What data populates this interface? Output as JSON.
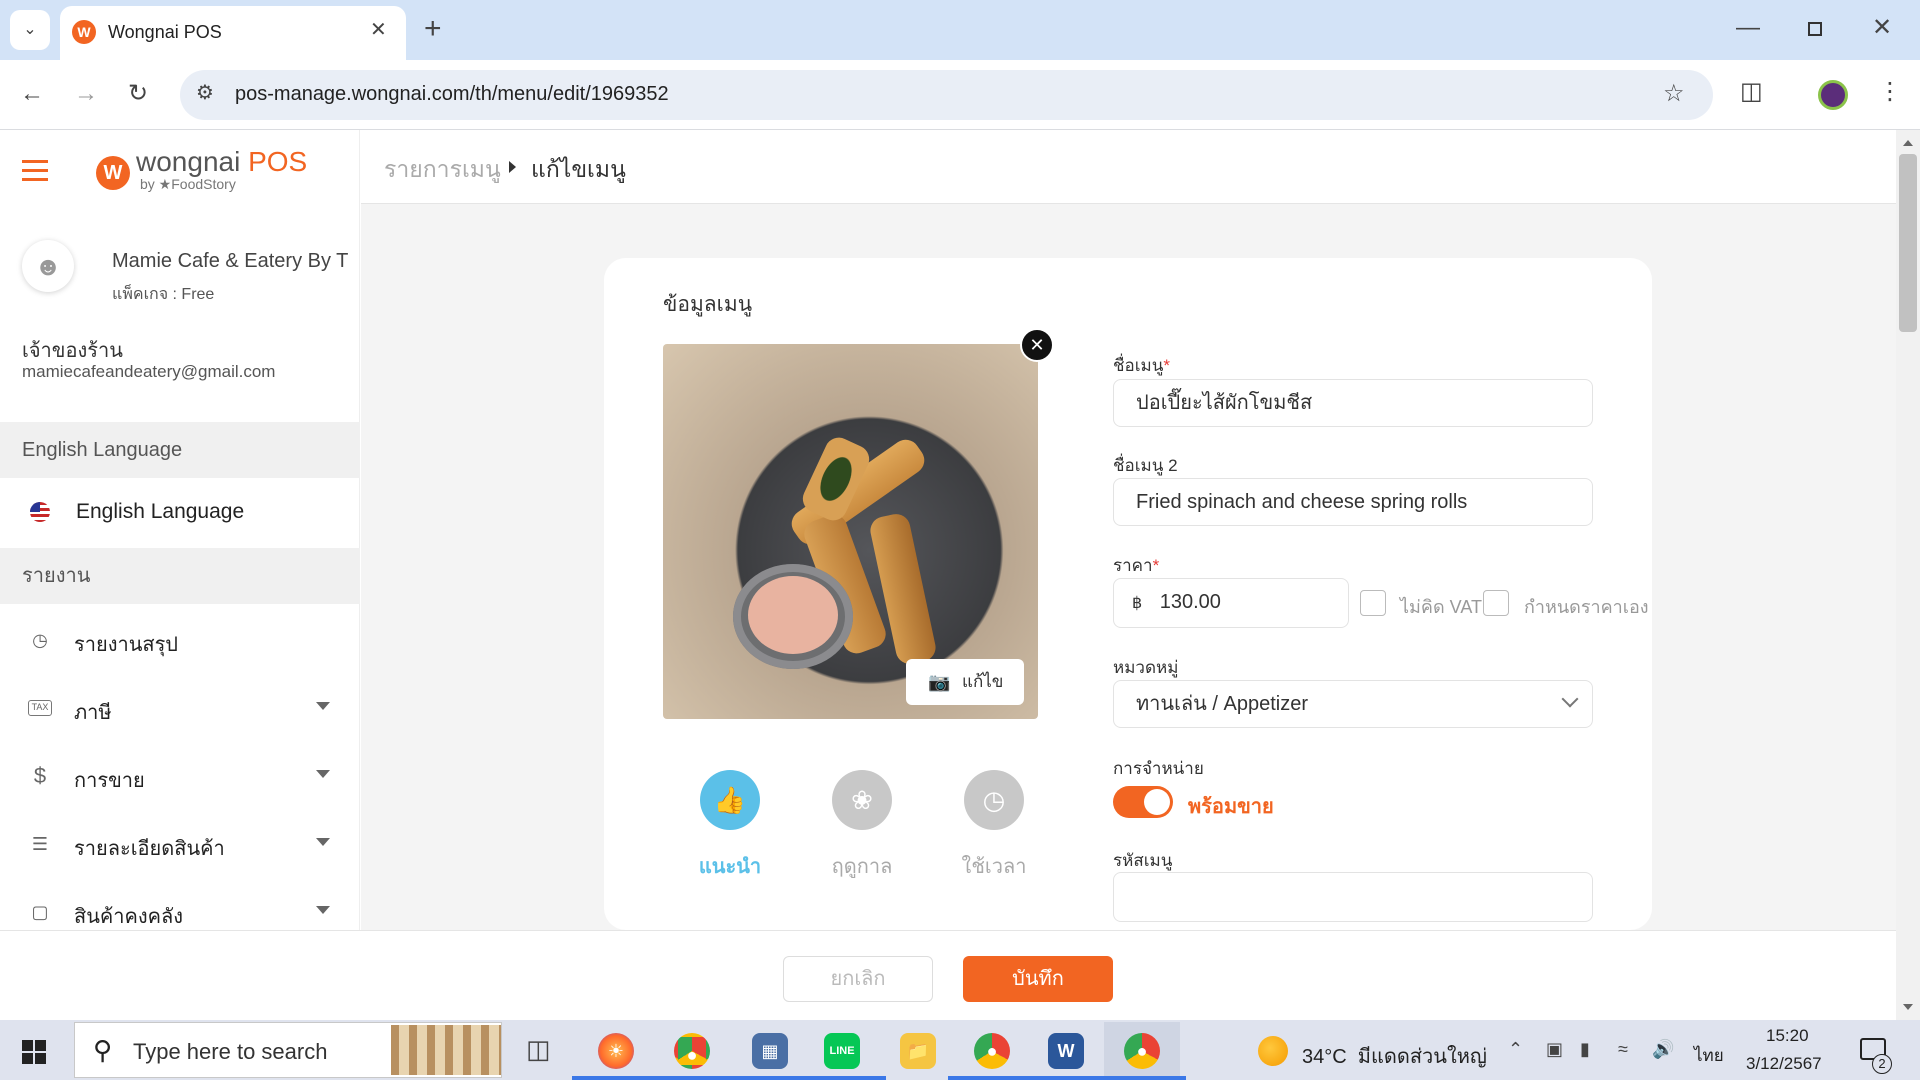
{
  "browser": {
    "tab_title": "Wongnai POS",
    "url": "pos-manage.wongnai.com/th/menu/edit/1969352"
  },
  "sidebar": {
    "brand": "wongnai",
    "brand_pos": "POS",
    "brand_sub": "by ★FoodStory",
    "shop_name": "Mamie Cafe & Eatery By T",
    "package": "แพ็คเกจ : Free",
    "role": "เจ้าของร้าน",
    "email": "mamiecafeandeatery@gmail.com",
    "language_header": "English Language",
    "language_item": "English Language",
    "report_header": "รายงาน",
    "items": [
      {
        "label": "รายงานสรุป",
        "icon": "pie-icon"
      },
      {
        "label": "ภาษี",
        "icon": "tax-icon"
      },
      {
        "label": "การขาย",
        "icon": "dollar-icon"
      },
      {
        "label": "รายละเอียดสินค้า",
        "icon": "list-icon"
      },
      {
        "label": "สินค้าคงคลัง",
        "icon": "box-icon"
      }
    ]
  },
  "breadcrumb": {
    "parent": "รายการเมนู",
    "current": "แก้ไขเมนู"
  },
  "card": {
    "title": "ข้อมูลเมนู",
    "edit_photo": "แก้ไข",
    "tags": [
      {
        "label": "แนะนำ",
        "active": true,
        "icon": "thumbs-up-icon"
      },
      {
        "label": "ฤดูกาล",
        "active": false,
        "icon": "leaf-icon"
      },
      {
        "label": "ใช้เวลา",
        "active": false,
        "icon": "clock-icon"
      }
    ],
    "menu_name_label": "ชื่อเมนู",
    "menu_name_value": "ปอเปี๊ยะไส้ผักโขมชีส",
    "menu_name2_label": "ชื่อเมนู 2",
    "menu_name2_value": "Fried spinach and cheese spring rolls",
    "price_label": "ราคา",
    "currency_symbol": "฿",
    "price_value": "130.00",
    "no_vat_label": "ไม่คิด VAT",
    "custom_price_label": "กำหนดราคาเอง",
    "category_label": "หมวดหมู่",
    "category_value": "ทานเล่น / Appetizer",
    "sale_label": "การจำหน่าย",
    "sale_status": "พร้อมขาย",
    "sale_on": true,
    "code_label": "รหัสเมนู",
    "code_value": ""
  },
  "footer": {
    "cancel": "ยกเลิก",
    "save": "บันทึก"
  },
  "taskbar": {
    "search_placeholder": "Type here to search",
    "weather": "34°C  มีแดดส่วนใหญ่",
    "lang": "ไทย",
    "time": "15:20",
    "date": "3/12/2567",
    "notif_count": "2"
  },
  "colors": {
    "accent": "#f26522",
    "tag_active": "#5bc0e8",
    "tag_inactive": "#c8c8c8"
  }
}
